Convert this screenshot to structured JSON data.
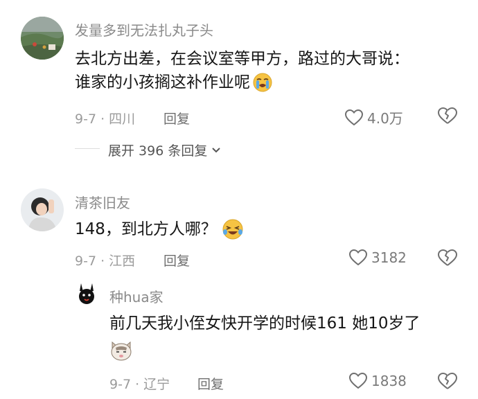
{
  "comments": [
    {
      "username": "发量多到无法扎丸子头",
      "text_line1": "去北方出差，在会议室等甲方，路过的大哥说：",
      "text_line2": "谁家的小孩搁这补作业呢",
      "meta": "9-7 · 四川",
      "reply_label": "回复",
      "likes": "4.0万",
      "emoji": "crying-face-emoji",
      "expand_label": "展开 396 条回复"
    },
    {
      "username": "清茶旧友",
      "text": "148，到北方人哪？",
      "meta": "9-7 · 江西",
      "reply_label": "回复",
      "likes": "3182",
      "emoji": "tearful-laugh-emoji"
    }
  ],
  "reply": {
    "username": "种hua家",
    "text": "前几天我小侄女快开学的时候161  她10岁了",
    "meta": "9-7 · 辽宁",
    "reply_label": "回复",
    "likes": "1838",
    "emoji": "cat-face-emoji"
  },
  "icons": {
    "like": "heart-outline-icon",
    "dislike": "broken-heart-icon",
    "expand": "chevron-down-icon"
  },
  "colors": {
    "username": "#8a8a8a",
    "meta": "#9b9b9b",
    "text": "#161616",
    "emoji_yellow": "#f6c343"
  }
}
